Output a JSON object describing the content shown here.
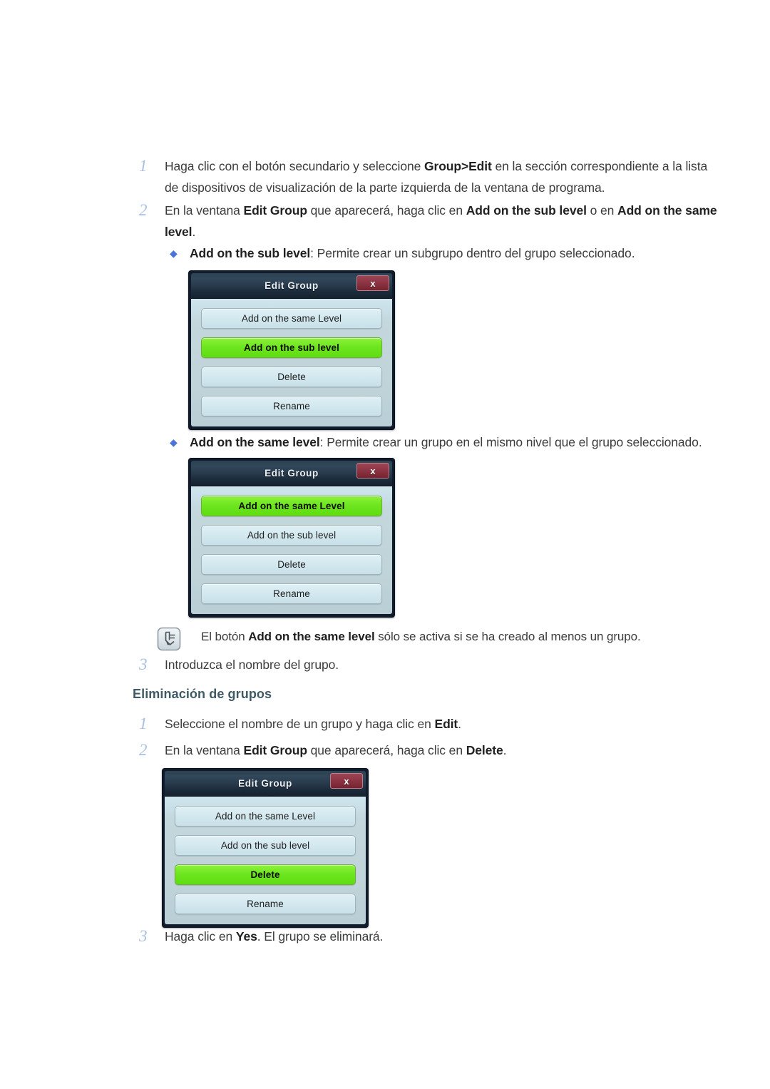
{
  "steps_group_creation": [
    {
      "number": "1",
      "segments": [
        {
          "t": "Haga clic con el botón secundario y seleccione ",
          "b": false
        },
        {
          "t": "Group>Edit",
          "b": true
        },
        {
          "t": " en la sección correspondiente a la lista de dispositivos de visualización de la parte izquierda de la ventana de programa.",
          "b": false
        }
      ]
    },
    {
      "number": "2",
      "segments": [
        {
          "t": "En la ventana ",
          "b": false
        },
        {
          "t": "Edit Group",
          "b": true
        },
        {
          "t": " que aparecerá, haga clic en ",
          "b": false
        },
        {
          "t": "Add on the sub level",
          "b": true
        },
        {
          "t": " o en ",
          "b": false
        },
        {
          "t": "Add on the same level",
          "b": true
        },
        {
          "t": ".",
          "b": false
        }
      ]
    }
  ],
  "bullet_sub_level": {
    "marker": "bullet-diamond-icon",
    "segments": [
      {
        "t": "Add on the sub level",
        "b": true
      },
      {
        "t": ": Permite crear un subgrupo dentro del grupo seleccionado.",
        "b": false
      }
    ]
  },
  "bullet_same_level": {
    "marker": "bullet-diamond-icon",
    "segments": [
      {
        "t": "Add on the same level",
        "b": true
      },
      {
        "t": ": Permite crear un grupo en el mismo nivel que el grupo seleccionado.",
        "b": false
      }
    ]
  },
  "note": {
    "icon": "note-pencil-icon",
    "segments": [
      {
        "t": "El botón ",
        "b": false
      },
      {
        "t": "Add on the same level",
        "b": true
      },
      {
        "t": " sólo se activa si se ha creado al menos un grupo.",
        "b": false
      }
    ]
  },
  "step_enter_name": {
    "number": "3",
    "segments": [
      {
        "t": "Introduzca el nombre del grupo.",
        "b": false
      }
    ]
  },
  "section_heading_delete": "Eliminación de grupos",
  "steps_group_deletion": [
    {
      "number": "1",
      "segments": [
        {
          "t": "Seleccione el nombre de un grupo y haga clic en ",
          "b": false
        },
        {
          "t": "Edit",
          "b": true
        },
        {
          "t": ".",
          "b": false
        }
      ]
    },
    {
      "number": "2",
      "segments": [
        {
          "t": "En la ventana ",
          "b": false
        },
        {
          "t": "Edit Group",
          "b": true
        },
        {
          "t": " que aparecerá, haga clic en ",
          "b": false
        },
        {
          "t": "Delete",
          "b": true
        },
        {
          "t": ".",
          "b": false
        }
      ]
    }
  ],
  "step_confirm_yes": {
    "number": "3",
    "segments": [
      {
        "t": "Haga clic en ",
        "b": false
      },
      {
        "t": "Yes",
        "b": true
      },
      {
        "t": ". El grupo se eliminará.",
        "b": false
      }
    ]
  },
  "dialogs": [
    {
      "id": "dialog-add-sub-level",
      "title": "Edit Group",
      "close_label": "x",
      "buttons": [
        {
          "label": "Add on the same Level",
          "highlighted": false
        },
        {
          "label": "Add on the sub level",
          "highlighted": true
        },
        {
          "label": "Delete",
          "highlighted": false
        },
        {
          "label": "Rename",
          "highlighted": false
        }
      ]
    },
    {
      "id": "dialog-add-same-level",
      "title": "Edit Group",
      "close_label": "x",
      "buttons": [
        {
          "label": "Add on the same Level",
          "highlighted": true
        },
        {
          "label": "Add on the sub level",
          "highlighted": false
        },
        {
          "label": "Delete",
          "highlighted": false
        },
        {
          "label": "Rename",
          "highlighted": false
        }
      ]
    },
    {
      "id": "dialog-delete",
      "title": "Edit Group",
      "close_label": "x",
      "buttons": [
        {
          "label": "Add on the same Level",
          "highlighted": false
        },
        {
          "label": "Add on the sub level",
          "highlighted": false
        },
        {
          "label": "Delete",
          "highlighted": true
        },
        {
          "label": "Rename",
          "highlighted": false
        }
      ]
    }
  ],
  "colors": {
    "step_number": "#a9bfe2",
    "heading": "#3f5a66",
    "bullet": "#4c74d9",
    "dialog_highlight_green": "#6ee61f",
    "dialog_titlebar": "#27394a",
    "dialog_close_red": "#8d3545",
    "dialog_body": "#c3d7dd"
  }
}
